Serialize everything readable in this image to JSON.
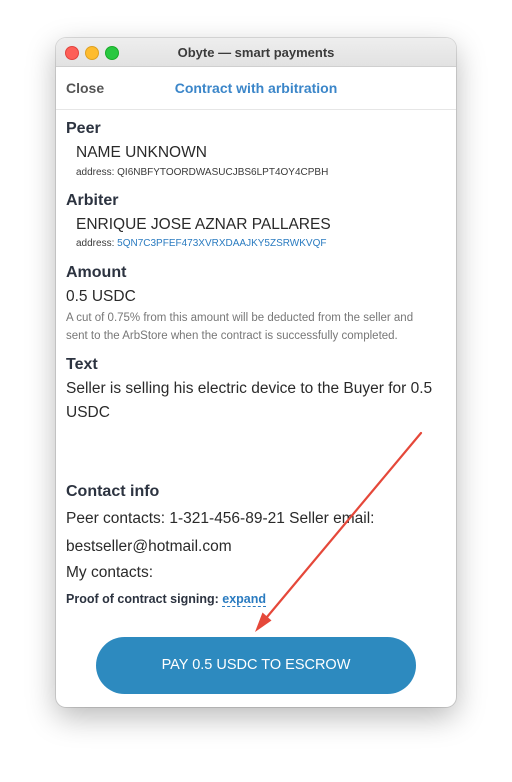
{
  "window": {
    "title": "Obyte — smart payments"
  },
  "nav": {
    "close_label": "Close",
    "title": "Contract with arbitration"
  },
  "peer": {
    "heading": "Peer",
    "name": "NAME UNKNOWN",
    "address_label": "address:",
    "address": "QI6NBFYTOORDWASUCJBS6LPT4OY4CPBH"
  },
  "arbiter": {
    "heading": "Arbiter",
    "name": "ENRIQUE JOSE AZNAR PALLARES",
    "address_label": "address:",
    "address": "5QN7C3PFEF473XVRXDAAJKY5ZSRWKVQF"
  },
  "amount": {
    "heading": "Amount",
    "value": "0.5 USDC",
    "note": "A cut of 0.75% from this amount will be deducted from the seller and sent to the ArbStore when the contract is successfully completed."
  },
  "text": {
    "heading": "Text",
    "body": "Seller is selling his electric device to the Buyer for 0.5 USDC"
  },
  "contact": {
    "heading": "Contact info",
    "peer_line": "Peer contacts: 1-321-456-89-21 Seller email:",
    "peer_line2": "bestseller@hotmail.com",
    "my_line": "My contacts:",
    "proof_label": "Proof of contract signing:",
    "expand_label": "expand"
  },
  "pay_button": {
    "label": "PAY 0.5 USDC TO ESCROW"
  },
  "colors": {
    "accent": "#3b86c9",
    "button": "#2d8abf",
    "arrow": "#e5483a"
  }
}
